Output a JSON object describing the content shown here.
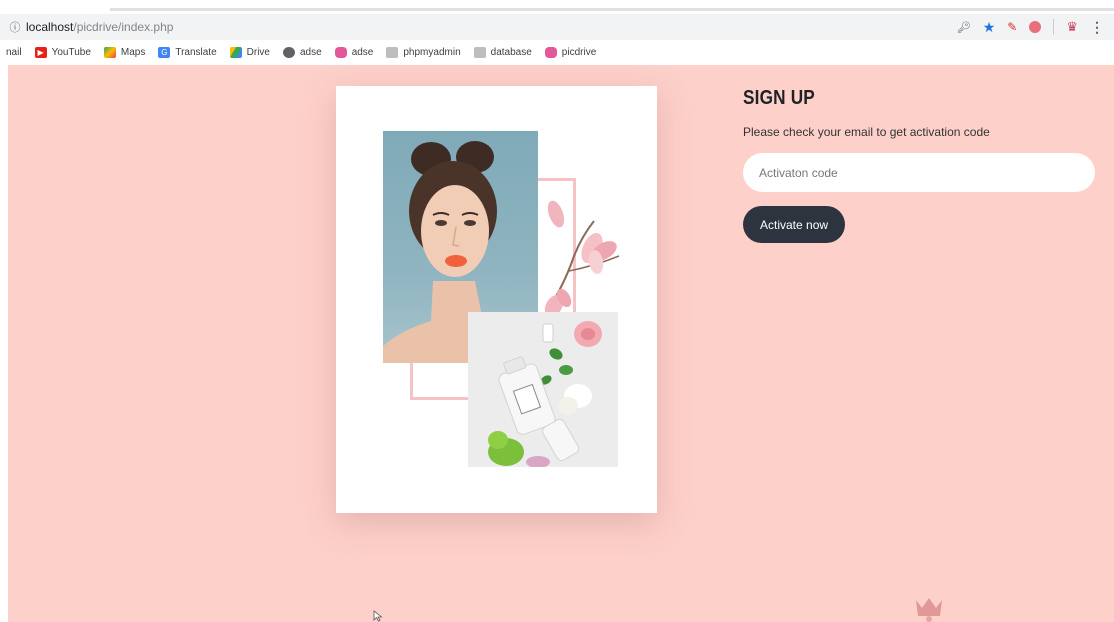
{
  "browser": {
    "url_host": "localhost",
    "url_path": "/picdrive/index.php",
    "bookmarks": [
      {
        "label": "nail",
        "icon": "gmail-icon"
      },
      {
        "label": "YouTube",
        "icon": "youtube-icon",
        "color": "#e62117"
      },
      {
        "label": "Maps",
        "icon": "maps-icon",
        "color": "#34a853"
      },
      {
        "label": "Translate",
        "icon": "translate-icon",
        "color": "#4285f4"
      },
      {
        "label": "Drive",
        "icon": "drive-icon",
        "color": "#fbbc04"
      },
      {
        "label": "adse",
        "icon": "globe-icon",
        "color": "#5f6368"
      },
      {
        "label": "adse",
        "icon": "pink-app-icon",
        "color": "#e4589a"
      },
      {
        "label": "phpmyadmin",
        "icon": "folder-icon",
        "color": "#9aa0a6"
      },
      {
        "label": "database",
        "icon": "folder-icon",
        "color": "#9aa0a6"
      },
      {
        "label": "picdrive",
        "icon": "pink-app-icon",
        "color": "#e4589a"
      }
    ]
  },
  "signup": {
    "title": "SIGN UP",
    "message": "Please check your email to get activation code",
    "code_placeholder": "Activaton code",
    "code_value": "",
    "activate_label": "Activate now"
  },
  "colors": {
    "page_bg": "#fdd0ca",
    "button_bg": "#2e3340",
    "card_bg": "#ffffff"
  }
}
